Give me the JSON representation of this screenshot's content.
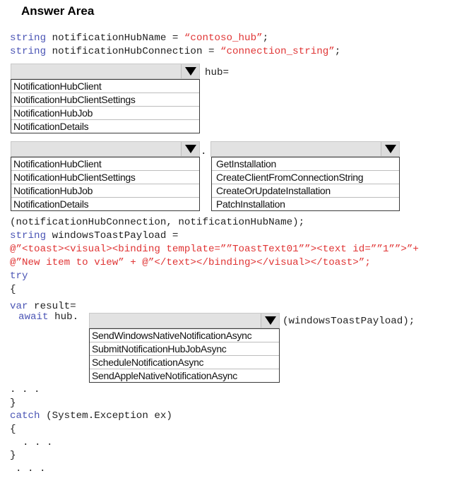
{
  "title": "Answer Area",
  "code": {
    "line1": {
      "kw": "string",
      "text": " notificationHubName = ",
      "str": "“contoso_hub”",
      "end": ";"
    },
    "line2": {
      "kw": "string",
      "text": " notificationHubConnection = ",
      "str": "“connection_string”",
      "end": ";"
    },
    "hub_assign": "hub=",
    "dot": ".",
    "line_args": "(notificationHubConnection, notificationHubName);",
    "line_payload": {
      "kw": "string",
      "text": " windowsToastPayload ="
    },
    "line_xml1": "@”<toast><visual><binding template=””ToastText01””><text id=””1””>”+",
    "line_xml2": "@”New item to view” + @”</text></binding></visual></toast>”;",
    "try_kw": "try",
    "open_brace1": "{",
    "var_line": {
      "kw": "var",
      "text": " result="
    },
    "await_line": {
      "kw": "await",
      "text": " hub."
    },
    "send_args": "(windowsToastPayload);",
    "ellipsis1": ". . .",
    "close_brace1": "}",
    "catch_line": {
      "kw": "catch",
      "text": " (System.Exception ex)"
    },
    "open_brace2": "{",
    "ellipsis2": ". . .",
    "close_brace2": "}",
    "ellipsis3": ". . ."
  },
  "dropdowns": {
    "type1": {
      "selected": "",
      "options": [
        "NotificationHubClient",
        "NotificationHubClientSettings",
        "NotificationHubJob",
        "NotificationDetails"
      ]
    },
    "type2": {
      "selected": "",
      "options": [
        "NotificationHubClient",
        "NotificationHubClientSettings",
        "NotificationHubJob",
        "NotificationDetails"
      ]
    },
    "method": {
      "selected": "",
      "options": [
        "GetInstallation",
        "CreateClientFromConnectionString",
        "CreateOrUpdateInstallation",
        "PatchInstallation"
      ]
    },
    "send": {
      "selected": "",
      "options": [
        "SendWindowsNativeNotificationAsync",
        "SubmitNotificationHubJobAsync",
        "ScheduleNotificationAsync",
        "SendAppleNativeNotificationAsync"
      ]
    }
  }
}
